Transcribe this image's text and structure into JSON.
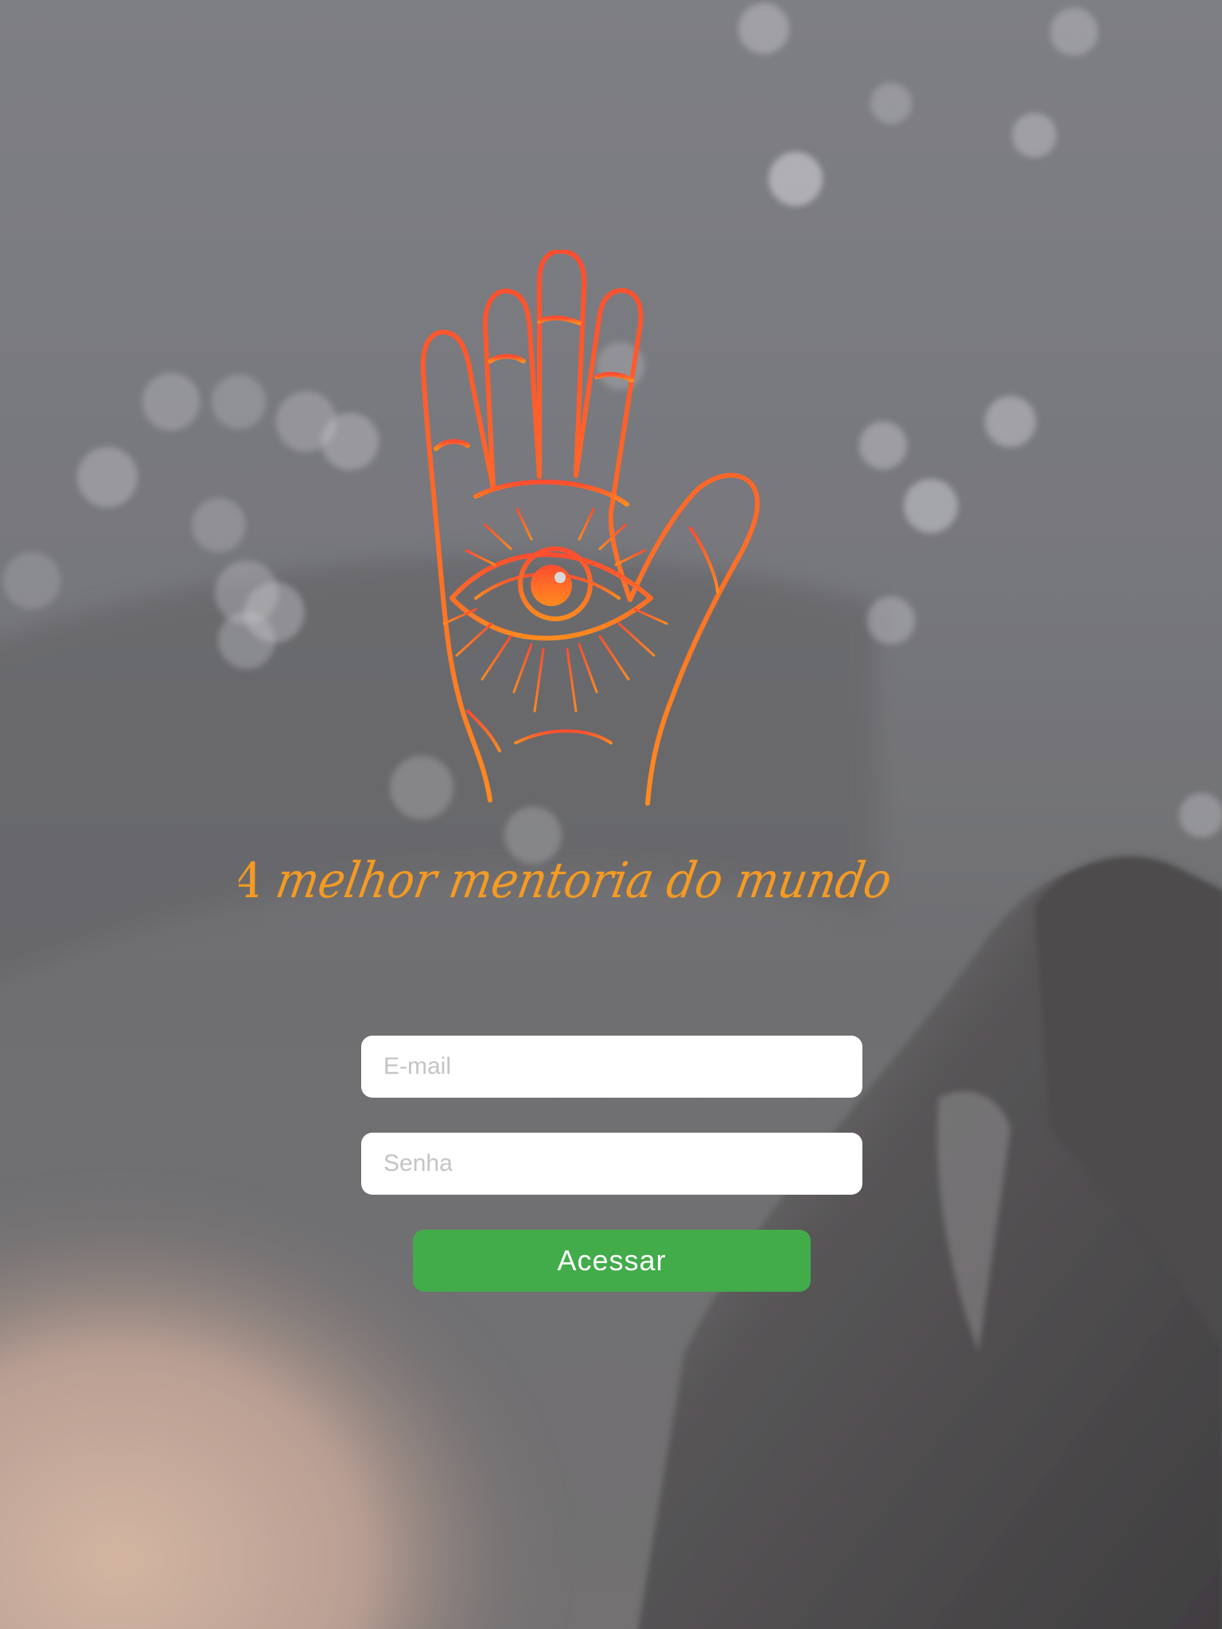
{
  "brand": {
    "logo_icon": "hand-eye-icon",
    "tagline": "A melhor mentoria do mundo",
    "colors": {
      "accent_top": "#ff4d30",
      "accent_bottom": "#ff8a1f",
      "tagline": "#f59a22"
    }
  },
  "login": {
    "email_placeholder": "E-mail",
    "password_placeholder": "Senha",
    "submit_label": "Acessar",
    "colors": {
      "field_bg": "#ffffff",
      "placeholder": "#c4c4c4",
      "button_bg": "#42ac4a",
      "button_text": "#ffffff"
    }
  }
}
